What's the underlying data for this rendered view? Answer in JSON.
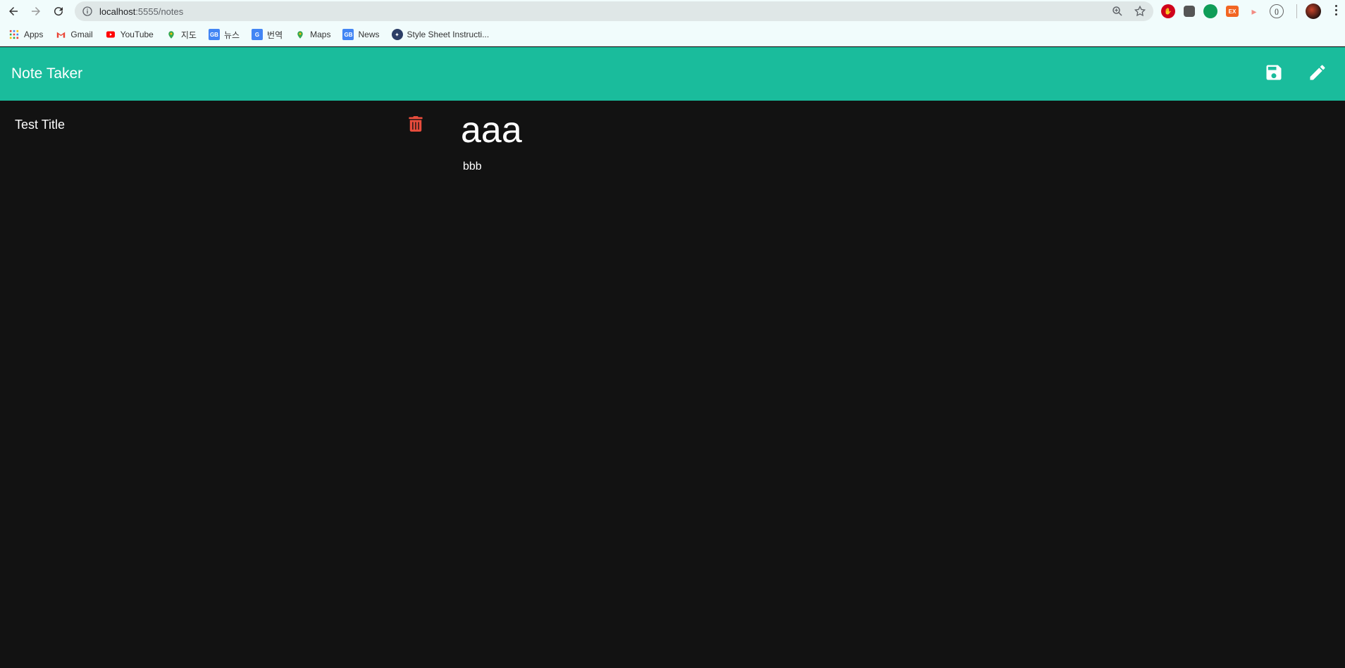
{
  "browser": {
    "url_host": "localhost",
    "url_rest": ":5555/notes",
    "bookmarks": [
      {
        "label": "Apps",
        "icon": "apps-grid-icon"
      },
      {
        "label": "Gmail",
        "icon": "gmail-icon"
      },
      {
        "label": "YouTube",
        "icon": "youtube-icon"
      },
      {
        "label": "지도",
        "icon": "maps-pin-icon"
      },
      {
        "label": "뉴스",
        "icon": "news-icon"
      },
      {
        "label": "번역",
        "icon": "translate-icon"
      },
      {
        "label": "Maps",
        "icon": "maps-pin-icon"
      },
      {
        "label": "News",
        "icon": "news-icon"
      },
      {
        "label": "Style Sheet Instructi...",
        "icon": "seal-icon"
      }
    ],
    "extensions": [
      {
        "name": "adblock-icon",
        "color": "#d0021b"
      },
      {
        "name": "extension-icon",
        "color": "#555555"
      },
      {
        "name": "hangouts-icon",
        "color": "#0f9d58"
      },
      {
        "name": "ex-icon",
        "color": "#f26522"
      },
      {
        "name": "extension-pink-icon",
        "color": "#f28b82"
      },
      {
        "name": "code-icon",
        "color": "#666666"
      }
    ]
  },
  "app": {
    "brand": "Note Taker",
    "accent": "#1abc9c",
    "danger": "#e74c3c",
    "background": "#121212"
  },
  "notes": {
    "items": [
      {
        "title": "Test Title"
      }
    ]
  },
  "active_note": {
    "title": "aaa",
    "text": "bbb"
  }
}
